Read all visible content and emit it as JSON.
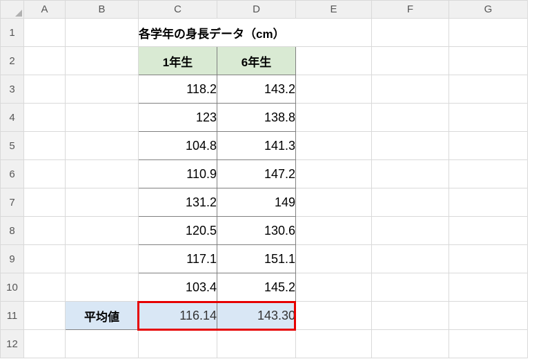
{
  "columns": [
    "A",
    "B",
    "C",
    "D",
    "E",
    "F",
    "G"
  ],
  "rows": [
    "1",
    "2",
    "3",
    "4",
    "5",
    "6",
    "7",
    "8",
    "9",
    "10",
    "11",
    "12"
  ],
  "title": "各学年の身長データ（cm）",
  "headers": {
    "c": "1年生",
    "d": "6年生"
  },
  "grade1": [
    "118.2",
    "123",
    "104.8",
    "110.9",
    "131.2",
    "120.5",
    "117.1",
    "103.4"
  ],
  "grade6": [
    "143.2",
    "138.8",
    "141.3",
    "147.2",
    "149",
    "130.6",
    "151.1",
    "145.2"
  ],
  "avg_label": "平均値",
  "avg": {
    "c": "116.14",
    "d": "143.30"
  },
  "chart_data": {
    "type": "table",
    "title": "各学年の身長データ（cm）",
    "categories": [
      "1年生",
      "6年生"
    ],
    "series": [
      {
        "name": "1年生",
        "values": [
          118.2,
          123,
          104.8,
          110.9,
          131.2,
          120.5,
          117.1,
          103.4
        ]
      },
      {
        "name": "6年生",
        "values": [
          143.2,
          138.8,
          141.3,
          147.2,
          149,
          130.6,
          151.1,
          145.2
        ]
      }
    ],
    "averages": {
      "1年生": 116.14,
      "6年生": 143.3
    }
  }
}
